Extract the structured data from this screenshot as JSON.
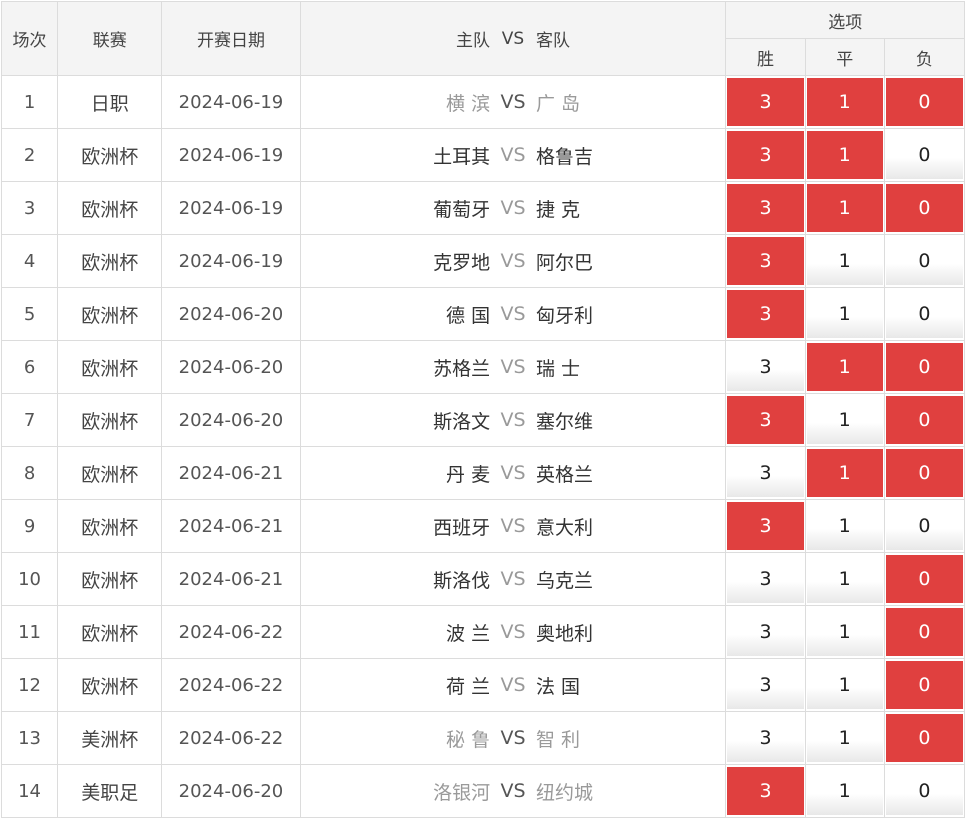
{
  "header": {
    "num": "场次",
    "league": "联赛",
    "date": "开赛日期",
    "home": "主队",
    "vs": "VS",
    "away": "客队",
    "options": "选项",
    "win": "胜",
    "draw": "平",
    "lose": "负"
  },
  "colors": {
    "selected": "#e0403f"
  },
  "rows": [
    {
      "num": "1",
      "league": "日职",
      "date": "2024-06-19",
      "home": "横 滨",
      "vs": "VS",
      "away": "广 岛",
      "win": "3",
      "draw": "1",
      "lose": "0",
      "sel": [
        true,
        true,
        true
      ],
      "dim": true
    },
    {
      "num": "2",
      "league": "欧洲杯",
      "date": "2024-06-19",
      "home": "土耳其",
      "vs": "VS",
      "away": "格鲁吉",
      "win": "3",
      "draw": "1",
      "lose": "0",
      "sel": [
        true,
        true,
        false
      ],
      "dim": false
    },
    {
      "num": "3",
      "league": "欧洲杯",
      "date": "2024-06-19",
      "home": "葡萄牙",
      "vs": "VS",
      "away": "捷 克",
      "win": "3",
      "draw": "1",
      "lose": "0",
      "sel": [
        true,
        true,
        true
      ],
      "dim": false
    },
    {
      "num": "4",
      "league": "欧洲杯",
      "date": "2024-06-19",
      "home": "克罗地",
      "vs": "VS",
      "away": "阿尔巴",
      "win": "3",
      "draw": "1",
      "lose": "0",
      "sel": [
        true,
        false,
        false
      ],
      "dim": false
    },
    {
      "num": "5",
      "league": "欧洲杯",
      "date": "2024-06-20",
      "home": "德 国",
      "vs": "VS",
      "away": "匈牙利",
      "win": "3",
      "draw": "1",
      "lose": "0",
      "sel": [
        true,
        false,
        false
      ],
      "dim": false
    },
    {
      "num": "6",
      "league": "欧洲杯",
      "date": "2024-06-20",
      "home": "苏格兰",
      "vs": "VS",
      "away": "瑞 士",
      "win": "3",
      "draw": "1",
      "lose": "0",
      "sel": [
        false,
        true,
        true
      ],
      "dim": false
    },
    {
      "num": "7",
      "league": "欧洲杯",
      "date": "2024-06-20",
      "home": "斯洛文",
      "vs": "VS",
      "away": "塞尔维",
      "win": "3",
      "draw": "1",
      "lose": "0",
      "sel": [
        true,
        false,
        true
      ],
      "dim": false
    },
    {
      "num": "8",
      "league": "欧洲杯",
      "date": "2024-06-21",
      "home": "丹 麦",
      "vs": "VS",
      "away": "英格兰",
      "win": "3",
      "draw": "1",
      "lose": "0",
      "sel": [
        false,
        true,
        true
      ],
      "dim": false
    },
    {
      "num": "9",
      "league": "欧洲杯",
      "date": "2024-06-21",
      "home": "西班牙",
      "vs": "VS",
      "away": "意大利",
      "win": "3",
      "draw": "1",
      "lose": "0",
      "sel": [
        true,
        false,
        false
      ],
      "dim": false
    },
    {
      "num": "10",
      "league": "欧洲杯",
      "date": "2024-06-21",
      "home": "斯洛伐",
      "vs": "VS",
      "away": "乌克兰",
      "win": "3",
      "draw": "1",
      "lose": "0",
      "sel": [
        false,
        false,
        true
      ],
      "dim": false
    },
    {
      "num": "11",
      "league": "欧洲杯",
      "date": "2024-06-22",
      "home": "波 兰",
      "vs": "VS",
      "away": "奥地利",
      "win": "3",
      "draw": "1",
      "lose": "0",
      "sel": [
        false,
        false,
        true
      ],
      "dim": false
    },
    {
      "num": "12",
      "league": "欧洲杯",
      "date": "2024-06-22",
      "home": "荷 兰",
      "vs": "VS",
      "away": "法 国",
      "win": "3",
      "draw": "1",
      "lose": "0",
      "sel": [
        false,
        false,
        true
      ],
      "dim": false
    },
    {
      "num": "13",
      "league": "美洲杯",
      "date": "2024-06-22",
      "home": "秘 鲁",
      "vs": "VS",
      "away": "智 利",
      "win": "3",
      "draw": "1",
      "lose": "0",
      "sel": [
        false,
        false,
        true
      ],
      "dim": true
    },
    {
      "num": "14",
      "league": "美职足",
      "date": "2024-06-20",
      "home": "洛银河",
      "vs": "VS",
      "away": "纽约城",
      "win": "3",
      "draw": "1",
      "lose": "0",
      "sel": [
        true,
        false,
        false
      ],
      "dim": true
    }
  ]
}
